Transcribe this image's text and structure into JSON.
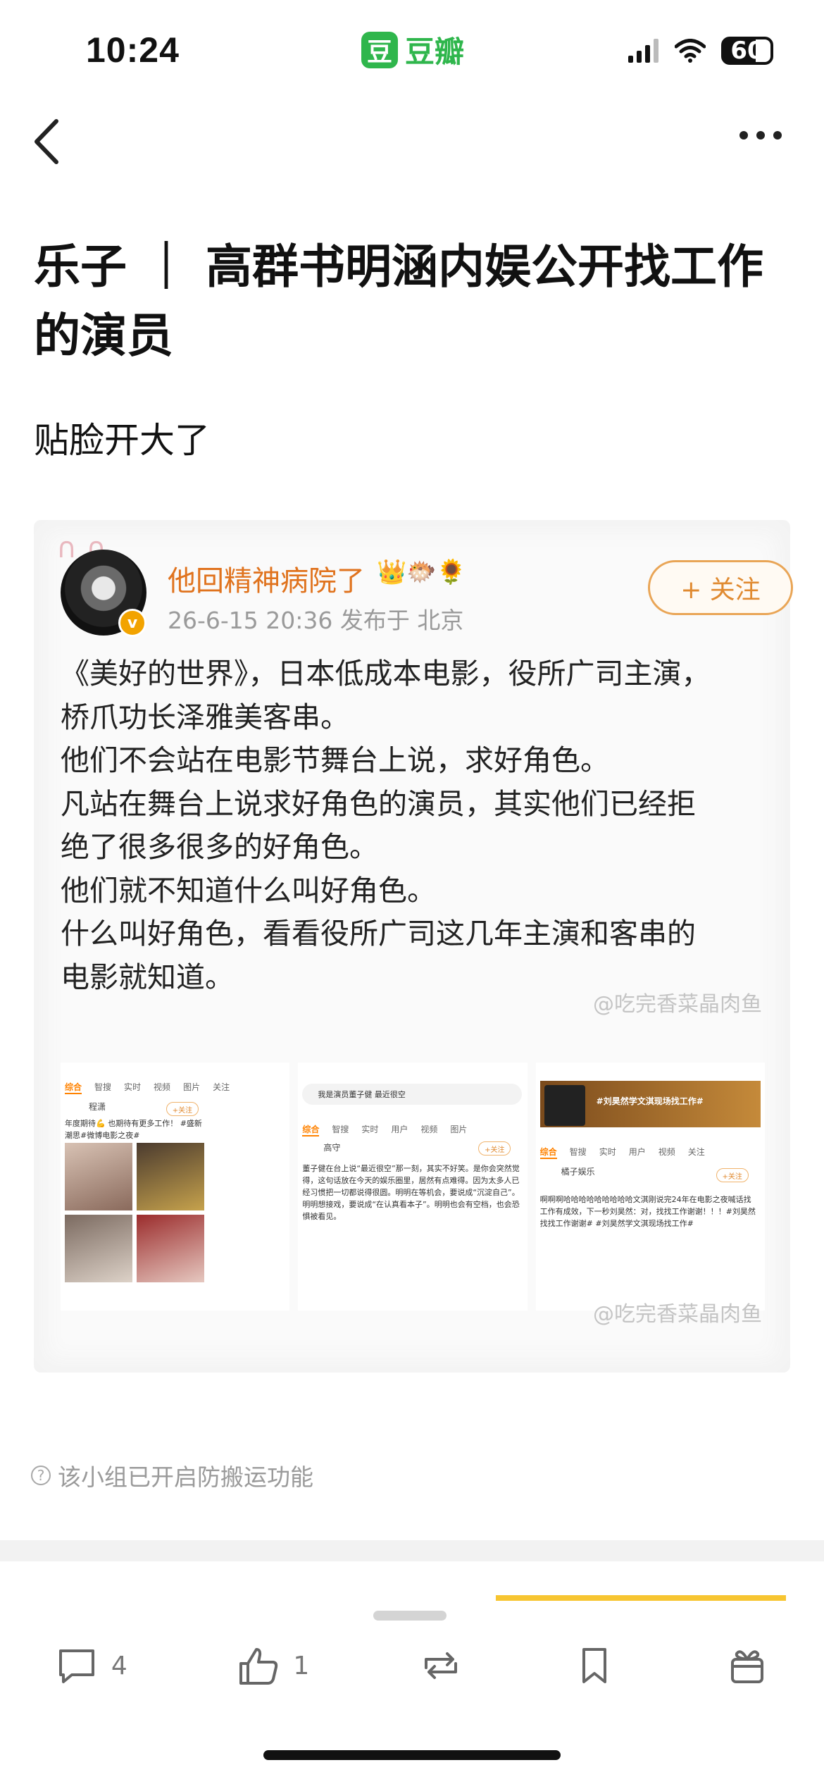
{
  "status_bar": {
    "time": "10:24",
    "app_badge_glyph": "豆",
    "app_name": "豆瓣",
    "battery": "60"
  },
  "post": {
    "title": "乐子 ｜ 高群书明涵内娱公开找工作的演员",
    "subtitle": "贴脸开大了"
  },
  "embed": {
    "author": "他回精神病院了",
    "author_icons": "👑🐡🌻",
    "meta": "26-6-15 20:36  发布于 北京",
    "follow_label": "+ 关注",
    "body": [
      "《美好的世界》，日本低成本电影，役所广司主演，",
      "桥爪功长泽雅美客串。",
      "他们不会站在电影节舞台上说，求好角色。",
      "凡站在舞台上说求好角色的演员，其实他们已经拒",
      "绝了很多很多的好角色。",
      "他们就不知道什么叫好角色。",
      "什么叫好角色，看看役所广司这几年主演和客串的",
      "电影就知道。"
    ],
    "watermark": "@吃完香菜晶肉鱼",
    "screens": {
      "s1": {
        "tabs": [
          "综合",
          "智搜",
          "实时",
          "视频",
          "图片",
          "关注"
        ],
        "user": "程潇",
        "follow": "+关注",
        "text": "年度期待💪 也期待有更多工作！ #盛新潮思#微博电影之夜#"
      },
      "s2": {
        "search": "我是演员董子健 最近很空",
        "tabs": [
          "综合",
          "智搜",
          "实时",
          "用户",
          "视频",
          "图片"
        ],
        "user": "高守",
        "follow": "+关注",
        "text": "董子健在台上说“最近很空”那一刻，其实不好笑。是你会突然觉得，这句话放在今天的娱乐圈里，居然有点难得。因为太多人已经习惯把一切都说得很圆。明明在等机会，要说成“沉淀自己”。明明想接戏，要说成“在认真看本子”。明明也会有空档，也会恐惧被看见。"
      },
      "s3": {
        "topic": "#刘昊然学文淇现场找工作#",
        "tabs": [
          "综合",
          "智搜",
          "实时",
          "用户",
          "视频",
          "关注"
        ],
        "user": "橘子娱乐",
        "follow": "+关注",
        "text": "啊啊啊哈哈哈哈哈哈哈哈哈文淇刚说完24年在电影之夜喊话找工作有成效，下一秒刘昊然：对，找找工作谢谢！！！#刘昊然 找找工作谢谢# #刘昊然学文淇现场找工作#"
      }
    }
  },
  "notice": "该小组已开启防搬运功能",
  "toolbar": {
    "comment_count": "4",
    "like_count": "1"
  },
  "colors": {
    "douban_green": "#2fb64c",
    "author_orange": "#e0731e",
    "accent_yellow": "#f7c531"
  }
}
